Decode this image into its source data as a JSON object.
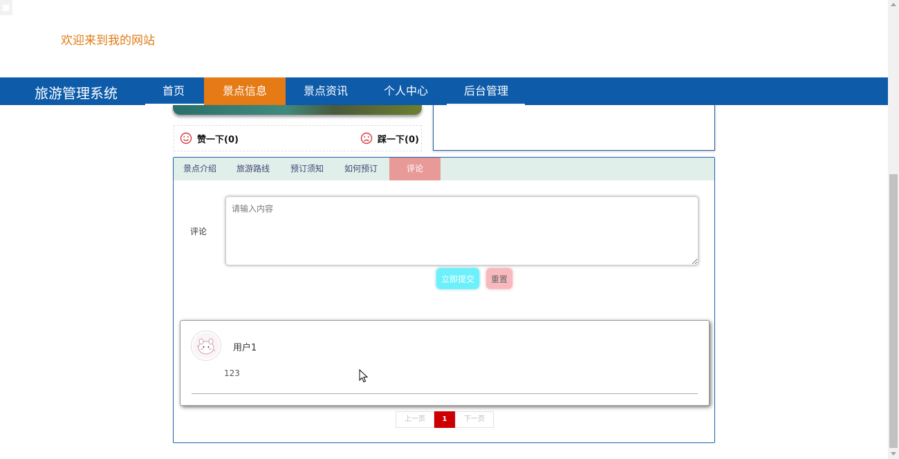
{
  "header": {
    "welcome": "欢迎来到我的网站"
  },
  "nav": {
    "brand": "旅游管理系统",
    "items": [
      {
        "label": "首页",
        "active": false
      },
      {
        "label": "景点信息",
        "active": true
      },
      {
        "label": "景点资讯",
        "active": false
      },
      {
        "label": "个人中心",
        "active": false
      },
      {
        "label": "后台管理",
        "active": false
      }
    ]
  },
  "votes": {
    "like": "赞一下(0)",
    "dislike": "踩一下(0)",
    "icon_color": "#d9363e"
  },
  "tabs": [
    {
      "label": "景点介绍",
      "active": false
    },
    {
      "label": "旅游路线",
      "active": false
    },
    {
      "label": "预订须知",
      "active": false
    },
    {
      "label": "如何预订",
      "active": false
    },
    {
      "label": "评论",
      "active": true
    }
  ],
  "comment_form": {
    "label": "评论",
    "placeholder": "请输入内容",
    "value": "",
    "submit_label": "立即提交",
    "reset_label": "重置"
  },
  "comments": [
    {
      "user": "用户1",
      "text": "123",
      "avatar_icon": "avatar-cartoon-icon"
    }
  ],
  "pagination": {
    "prev": "上一页",
    "current": "1",
    "next": "下一页"
  },
  "colors": {
    "nav_bg": "#0d5ba9",
    "nav_active": "#e67a15",
    "welcome": "#e07c16",
    "tab_active": "#e89a98",
    "submit": "#6cf0fb",
    "reset": "#f7b9bd",
    "page_current": "#cc0000"
  }
}
